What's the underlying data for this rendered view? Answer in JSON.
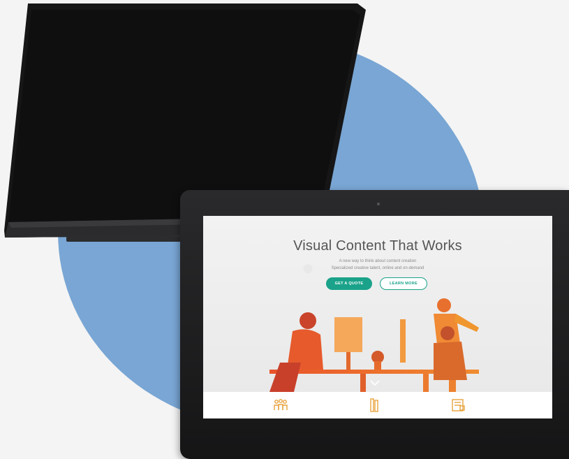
{
  "hero": {
    "title": "Visual Content That Works",
    "subtitle_1": "A new way to think about content creation",
    "subtitle_2": "Specialized creative talent, online and on-demand"
  },
  "buttons": {
    "quote_label": "GET A QUOTE",
    "learn_label": "LEARN MORE"
  },
  "footer_icons": [
    "people-icon",
    "pencils-icon",
    "document-icon"
  ],
  "colors": {
    "circle": "#79a6d4",
    "accent": "#1aa28a",
    "illustration": "#e8622d",
    "footer_icon": "#e8a23c"
  }
}
